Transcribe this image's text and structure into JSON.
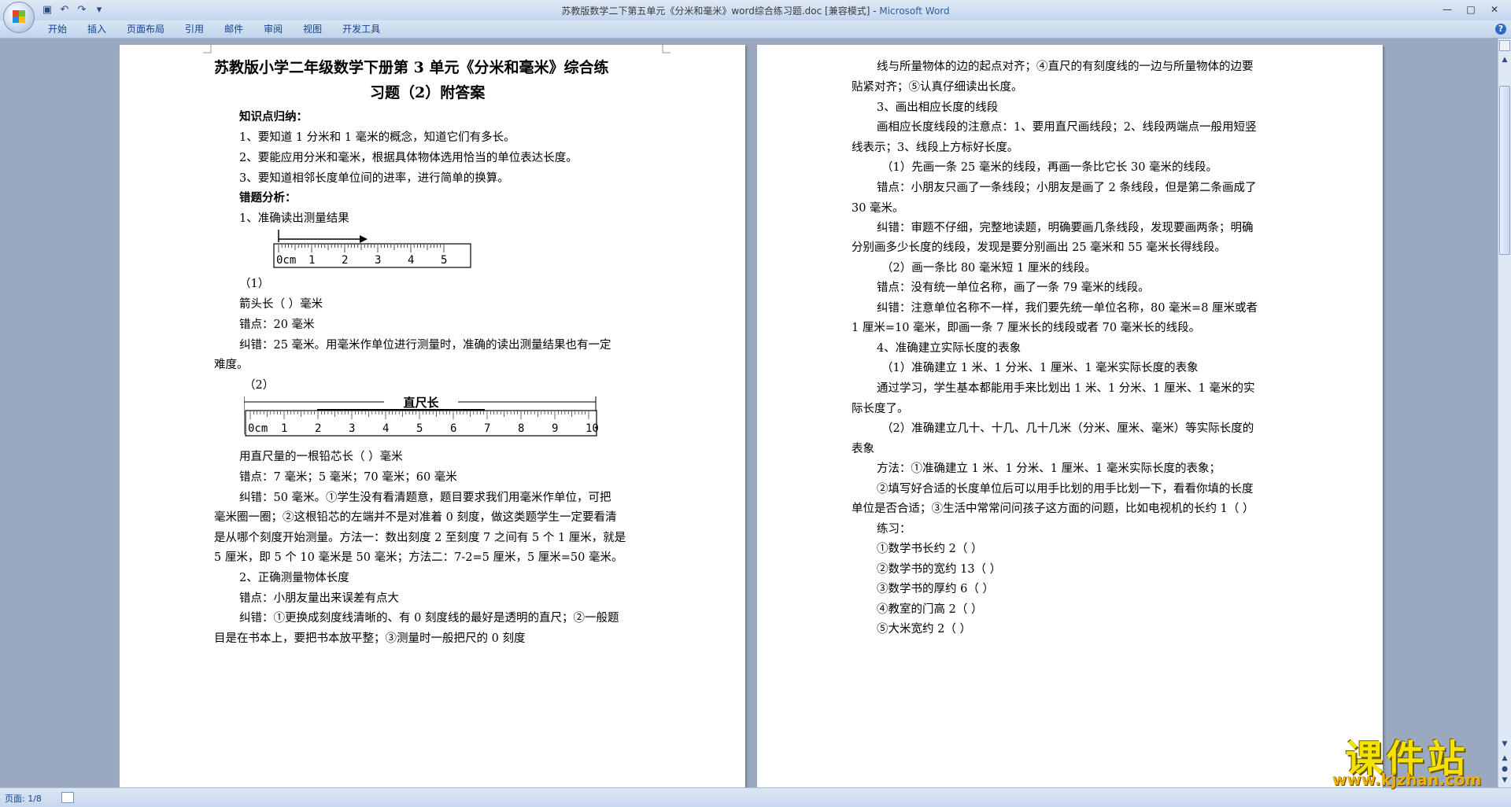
{
  "window": {
    "title": "苏教版数学二下第五单元《分米和毫米》word综合练习题.doc [兼容模式] - ",
    "app_name": "Microsoft Word",
    "minimize": "—",
    "maximize": "□",
    "close": "✕"
  },
  "ribbon": {
    "tabs": [
      "开始",
      "插入",
      "页面布局",
      "引用",
      "邮件",
      "审阅",
      "视图",
      "开发工具"
    ],
    "help": "?"
  },
  "status": {
    "page_info": "页面: 1/8"
  },
  "watermark": {
    "text": "课件站",
    "url": "www.kjzhan.com"
  },
  "page1": {
    "title_line1": "苏教版小学二年级数学下册第 3 单元《分米和毫米》综合练",
    "title_line2": "习题（2）附答案",
    "lines": [
      "知识点归纳：",
      "1、要知道 1 分米和 1 毫米的概念，知道它们有多长。",
      "2、要能应用分米和毫米，根据具体物体选用恰当的单位表达长度。",
      "3、要知道相邻长度单位间的进率，进行简单的换算。",
      "错题分析：",
      "1、准确读出测量结果",
      "（1）",
      "箭头长（ ）毫米",
      "错点：20 毫米",
      "纠错：25  毫米。用毫米作单位进行测量时，准确的读出测量结果也有一定",
      "难度。",
      "（2）",
      "用直尺量的一根铅芯长（ ）毫米",
      "错点：7 毫米；5 毫米；70 毫米；60 毫米",
      "纠错：50  毫米。①学生没有看清题意，题目要求我们用毫米作单位，可把",
      "毫米圈一圈；②这根铅芯的左端并不是对准着 0 刻度，做这类题学生一定要看清",
      "是从哪个刻度开始测量。方法一：数出刻度 2 至刻度 7 之间有 5 个 1 厘米，就是",
      "5 厘米，即 5 个 10 毫米是 50 毫米；方法二：7-2=5 厘米，5 厘米=50 毫米。",
      "2、正确测量物体长度",
      "错点：小朋友量出来误差有点大",
      "纠错：①更换成刻度线清晰的、有 0 刻度线的最好是透明的直尺；②一般题",
      "目是在书本上，要把书本放平整；③测量时一般把尺的 0 刻度"
    ],
    "ruler1_labels": [
      "0cm",
      "1",
      "2",
      "3",
      "4",
      "5"
    ],
    "ruler2_caption": "直尺长",
    "ruler2_labels": [
      "0cm",
      "1",
      "2",
      "3",
      "4",
      "5",
      "6",
      "7",
      "8",
      "9",
      "10"
    ]
  },
  "page2": {
    "lines": [
      "线与所量物体的边的起点对齐；④直尺的有刻度线的一边与所量物体的边要",
      "贴紧对齐；⑤认真仔细读出长度。",
      "3、画出相应长度的线段",
      "画相应长度线段的注意点：1、要用直尺画线段；2、线段两端点一般用短竖",
      "线表示；3、线段上方标好长度。",
      "（1）先画一条 25 毫米的线段，再画一条比它长 30 毫米的线段。",
      "错点：小朋友只画了一条线段；小朋友是画了 2 条线段，但是第二条画成了",
      "30 毫米。",
      "纠错：审题不仔细，完整地读题，明确要画几条线段，发现要画两条；明确",
      "分别画多少长度的线段，发现是要分别画出 25 毫米和 55 毫米长得线段。",
      "（2）画一条比 80 毫米短 1 厘米的线段。",
      "错点：没有统一单位名称，画了一条 79 毫米的线段。",
      "纠错：注意单位名称不一样，我们要先统一单位名称，80 毫米=8 厘米或者",
      "1 厘米=10 毫米，即画一条 7 厘米长的线段或者 70 毫米长的线段。",
      "4、准确建立实际长度的表象",
      "（1）准确建立 1 米、1 分米、1 厘米、1 毫米实际长度的表象",
      "通过学习，学生基本都能用手来比划出 1 米、1 分米、1 厘米、1 毫米的实",
      "际长度了。",
      "（2）准确建立几十、十几、几十几米（分米、厘米、毫米）等实际长度的",
      "表象",
      "方法：①准确建立 1 米、1 分米、1 厘米、1 毫米实际长度的表象；",
      "②填写好合适的长度单位后可以用手比划的用手比划一下，看看你填的长度",
      "单位是否合适；③生活中常常问问孩子这方面的问题，比如电视机的长约 1（  ）",
      "练习：",
      "①数学书长约 2（  ）",
      "②数学书的宽约 13（  ）",
      "③数学书的厚约 6（  ）",
      "④教室的门高 2（  ）",
      "⑤大米宽约 2（  ）"
    ]
  }
}
